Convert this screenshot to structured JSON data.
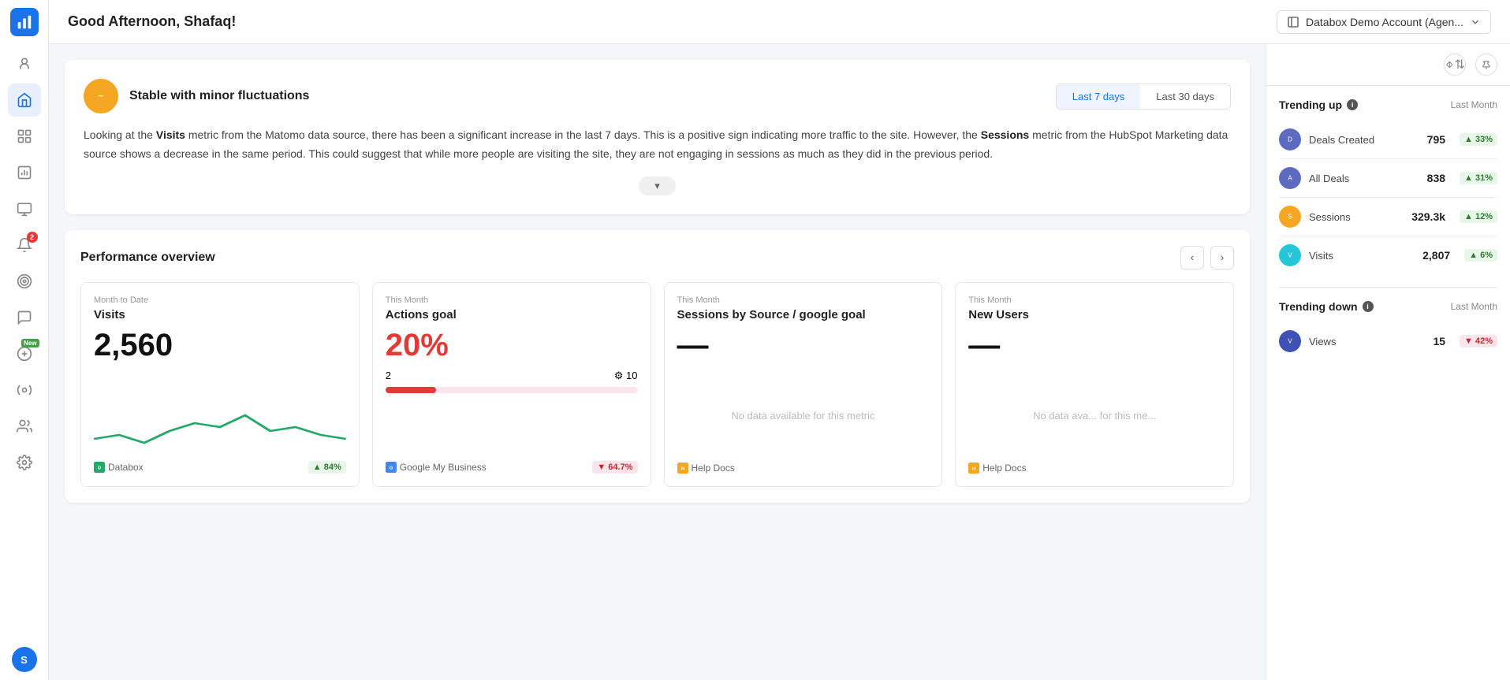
{
  "app": {
    "logo_alt": "Databox Logo"
  },
  "header": {
    "greeting": "Good Afternoon, Shafaq!",
    "account_selector": {
      "label": "Databox Demo Account (Agen...",
      "icon": "chevron-down-icon"
    }
  },
  "sidebar": {
    "items": [
      {
        "id": "team",
        "label": "Team",
        "icon": "team-icon",
        "active": false
      },
      {
        "id": "home",
        "label": "Home",
        "icon": "home-icon",
        "active": true
      },
      {
        "id": "numbers",
        "label": "Numbers",
        "icon": "numbers-icon",
        "active": false
      },
      {
        "id": "reports",
        "label": "Reports",
        "icon": "reports-icon",
        "active": false
      },
      {
        "id": "screens",
        "label": "Screens",
        "icon": "screens-icon",
        "active": false
      },
      {
        "id": "alerts",
        "label": "Alerts",
        "icon": "alerts-icon",
        "badge": "2",
        "active": false
      },
      {
        "id": "goals",
        "label": "Goals",
        "icon": "goals-icon",
        "active": false
      },
      {
        "id": "notifications",
        "label": "Notifications",
        "icon": "notifications-icon",
        "active": false
      },
      {
        "id": "new-feature",
        "label": "New Feature",
        "icon": "new-feature-icon",
        "new_badge": "New",
        "active": false
      },
      {
        "id": "integrations",
        "label": "Integrations",
        "icon": "integrations-icon",
        "active": false
      },
      {
        "id": "team-mgmt",
        "label": "Team Management",
        "icon": "team-mgmt-icon",
        "active": false
      },
      {
        "id": "settings",
        "label": "Settings",
        "icon": "settings-icon",
        "active": false
      }
    ],
    "avatar": {
      "initials": "S",
      "color": "#1a73e8"
    }
  },
  "insight": {
    "icon_alt": "stable-icon",
    "title": "Stable with minor fluctuations",
    "tabs": [
      {
        "label": "Last 7 days",
        "active": true
      },
      {
        "label": "Last 30 days",
        "active": false
      }
    ],
    "body_html": "Looking at the <b>Visits</b> metric from the Matomo data source, there has been a significant increase in the last 7 days. This is a positive sign indicating more traffic to the site. However, the <b>Sessions</b> metric from the HubSpot Marketing data source shows a decrease in the same period. This could suggest that while more people are visiting the site, they are not engaging in sessions as much as they did in the previous period.",
    "toggle_label": "▾"
  },
  "performance": {
    "title": "Performance overview",
    "nav": {
      "prev": "‹",
      "next": "›"
    },
    "cards": [
      {
        "period": "Month to Date",
        "title": "Visits",
        "value": "2,560",
        "value_color": "black",
        "has_chart": true,
        "footer_source": "Databox",
        "footer_badge": "▲ 84%",
        "badge_type": "up"
      },
      {
        "period": "This Month",
        "title": "Actions goal",
        "value": "20%",
        "value_color": "red",
        "progress_current": "2",
        "progress_target": "⚙ 10",
        "progress_pct": 20,
        "footer_source": "Google My Business",
        "footer_badge": "▼ 64.7%",
        "badge_type": "down"
      },
      {
        "period": "This Month",
        "title": "Sessions by Source / google goal",
        "value": "—",
        "value_color": "black",
        "no_data": true,
        "no_data_text": "No data available for this metric",
        "footer_source": "Help Docs",
        "footer_badge": "",
        "badge_type": ""
      },
      {
        "period": "This Month",
        "title": "New Users",
        "value": "—",
        "value_color": "black",
        "no_data": true,
        "no_data_text": "No data ava... for this me...",
        "footer_source": "Help Docs",
        "footer_badge": "",
        "badge_type": ""
      }
    ]
  },
  "right_panel": {
    "sort_icon": "sort-icon",
    "pin_icon": "pin-icon",
    "trending_up": {
      "title": "Trending up",
      "period": "Last Month",
      "items": [
        {
          "name": "Deals Created",
          "value": "795",
          "badge": "▲ 33%",
          "badge_type": "up",
          "icon_bg": "#5c6bc0",
          "icon_letter": "D"
        },
        {
          "name": "All Deals",
          "value": "838",
          "badge": "▲ 31%",
          "badge_type": "up",
          "icon_bg": "#5c6bc0",
          "icon_letter": "A"
        },
        {
          "name": "Sessions",
          "value": "329.3k",
          "badge": "▲ 12%",
          "badge_type": "up",
          "icon_bg": "#f5a623",
          "icon_letter": "S"
        },
        {
          "name": "Visits",
          "value": "2,807",
          "badge": "▲ 6%",
          "badge_type": "up",
          "icon_bg": "#26c6da",
          "icon_letter": "V"
        }
      ]
    },
    "trending_down": {
      "title": "Trending down",
      "period": "Last Month",
      "items": [
        {
          "name": "Views",
          "value": "15",
          "badge": "▼ 42%",
          "badge_type": "down",
          "icon_bg": "#3f51b5",
          "icon_letter": "V"
        }
      ]
    }
  }
}
